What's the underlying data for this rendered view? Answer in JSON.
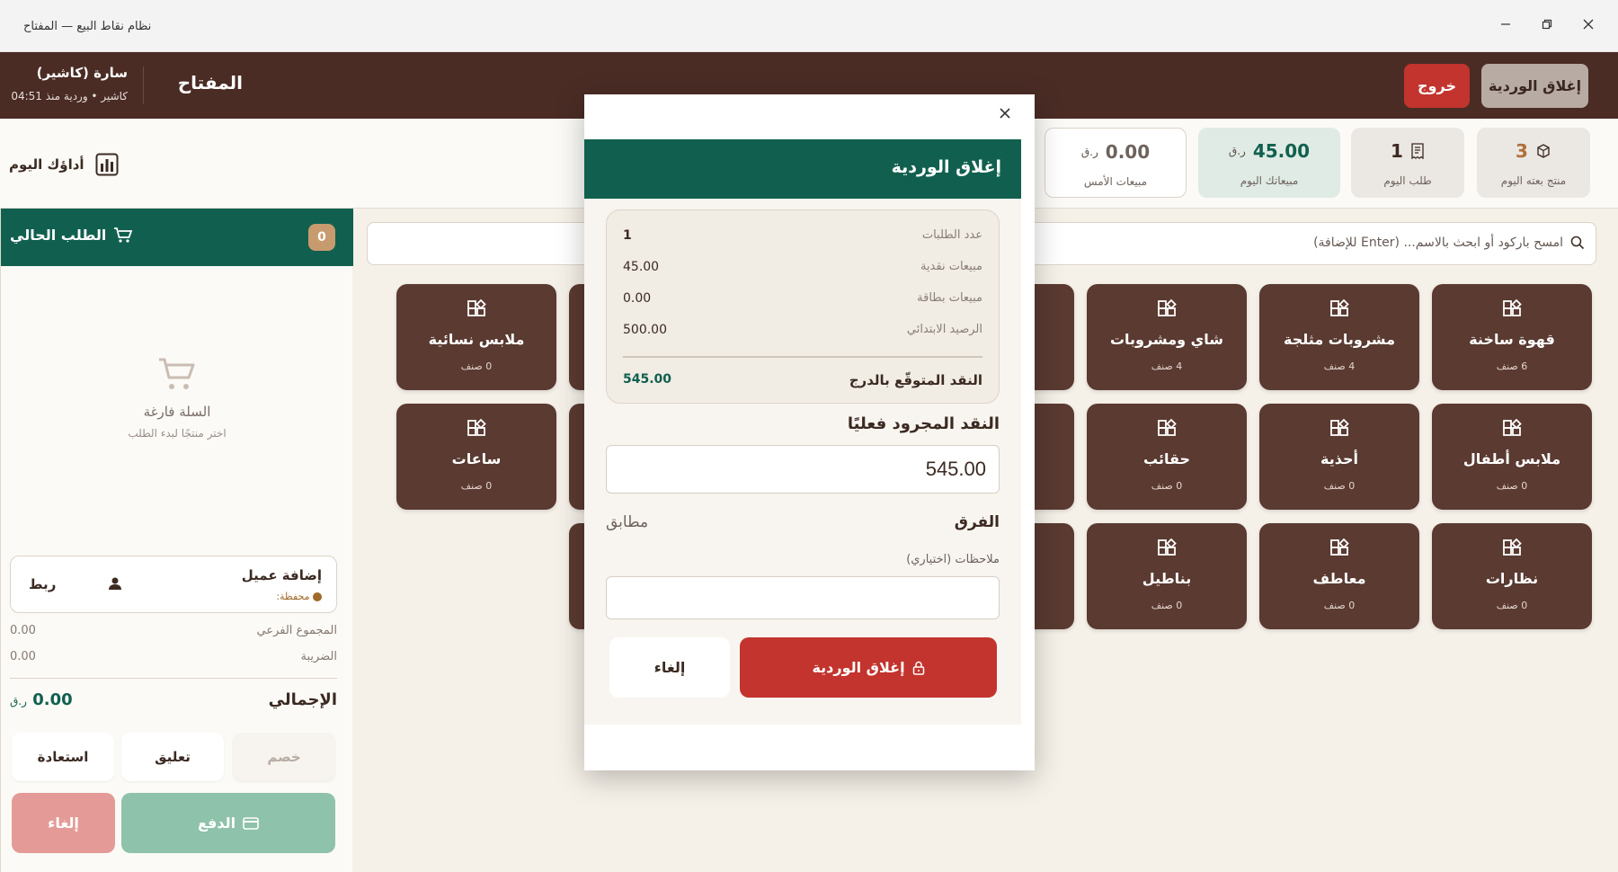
{
  "window": {
    "title": "نظام نقاط البيع — المفتاح",
    "controls": [
      "minimize-icon",
      "restore-icon",
      "close-icon"
    ]
  },
  "header": {
    "close_shift_label": "إغلاق الوردية",
    "logout_label": "خروج",
    "store_name": "المفتاح",
    "user_name": "سارة (كاشير)",
    "user_meta": "كاشير • وردية منذ 04:51"
  },
  "stats": {
    "items_sold": {
      "value": "3",
      "label": "منتج بعته اليوم",
      "icon": "box-icon"
    },
    "orders_today": {
      "value": "1",
      "label": "طلب اليوم",
      "icon": "receipt-icon"
    },
    "sales_today": {
      "value": "45.00",
      "unit": "ر.ق",
      "label": "مبيعاتك اليوم"
    },
    "sales_yesterday": {
      "value": "0.00",
      "unit": "ر.ق",
      "label": "مبيعات الأمس"
    },
    "performance_label": "أداؤك اليوم"
  },
  "order": {
    "title": "الطلب الحالي",
    "count": "0",
    "empty_title": "السلة فارغة",
    "empty_hint": "اختر منتجًا لبدء الطلب",
    "customer": {
      "add_label": "إضافة عميل",
      "wallet_label": "محفظة:",
      "link_label": "ربط"
    },
    "subtotal_label": "المجموع الفرعي",
    "subtotal_value": "0.00",
    "tax_label": "الضريبة",
    "tax_value": "0.00",
    "total_label": "الإجمالي",
    "total_value": "0.00",
    "currency": "ر.ق",
    "discount_label": "خصم",
    "hold_label": "تعليق",
    "restore_label": "استعادة",
    "pay_label": "الدفع",
    "cancel_label": "إلغاء"
  },
  "search": {
    "placeholder": "امسح باركود أو ابحث بالاسم... (Enter للإضافة)"
  },
  "categories": [
    {
      "name": "قهوة ساخنة",
      "count": "6 صنف"
    },
    {
      "name": "مشروبات مثلجة",
      "count": "4 صنف"
    },
    {
      "name": "شاي ومشروبات",
      "count": "4 صنف"
    },
    {
      "name": "ملابس نسائية",
      "count": "0 صنف"
    },
    {
      "name": "ملابس أطفال",
      "count": "0 صنف"
    },
    {
      "name": "أحذية",
      "count": "0 صنف"
    },
    {
      "name": "حقائب",
      "count": "0 صنف"
    },
    {
      "name": "ساعات",
      "count": "0 صنف"
    },
    {
      "name": "نظارات",
      "count": "0 صنف"
    },
    {
      "name": "معاطف",
      "count": "0 صنف"
    },
    {
      "name": "بناطيل",
      "count": "0 صنف"
    }
  ],
  "modal": {
    "title": "إغلاق الوردية",
    "summary": {
      "orders_label": "عدد الطلبات",
      "orders_value": "1",
      "cash_sales_label": "مبيعات نقدية",
      "cash_sales_value": "45.00",
      "card_sales_label": "مبيعات بطاقة",
      "card_sales_value": "0.00",
      "opening_label": "الرصيد الابتدائي",
      "opening_value": "500.00",
      "expected_label": "النقد المتوقّع بالدرج",
      "expected_value": "545.00"
    },
    "counted_label": "النقد المجرود فعليًا",
    "counted_value": "545.00",
    "diff_label": "الفرق",
    "diff_status": "مطابق",
    "notes_label": "ملاحظات (اختياري)",
    "notes_value": "",
    "confirm_label": "إغلاق الوردية",
    "cancel_label": "إلغاء"
  },
  "colors": {
    "brand_dark": "#4a2c25",
    "accent_green": "#11604f",
    "danger": "#c2342d",
    "tile": "#5a3a31"
  }
}
